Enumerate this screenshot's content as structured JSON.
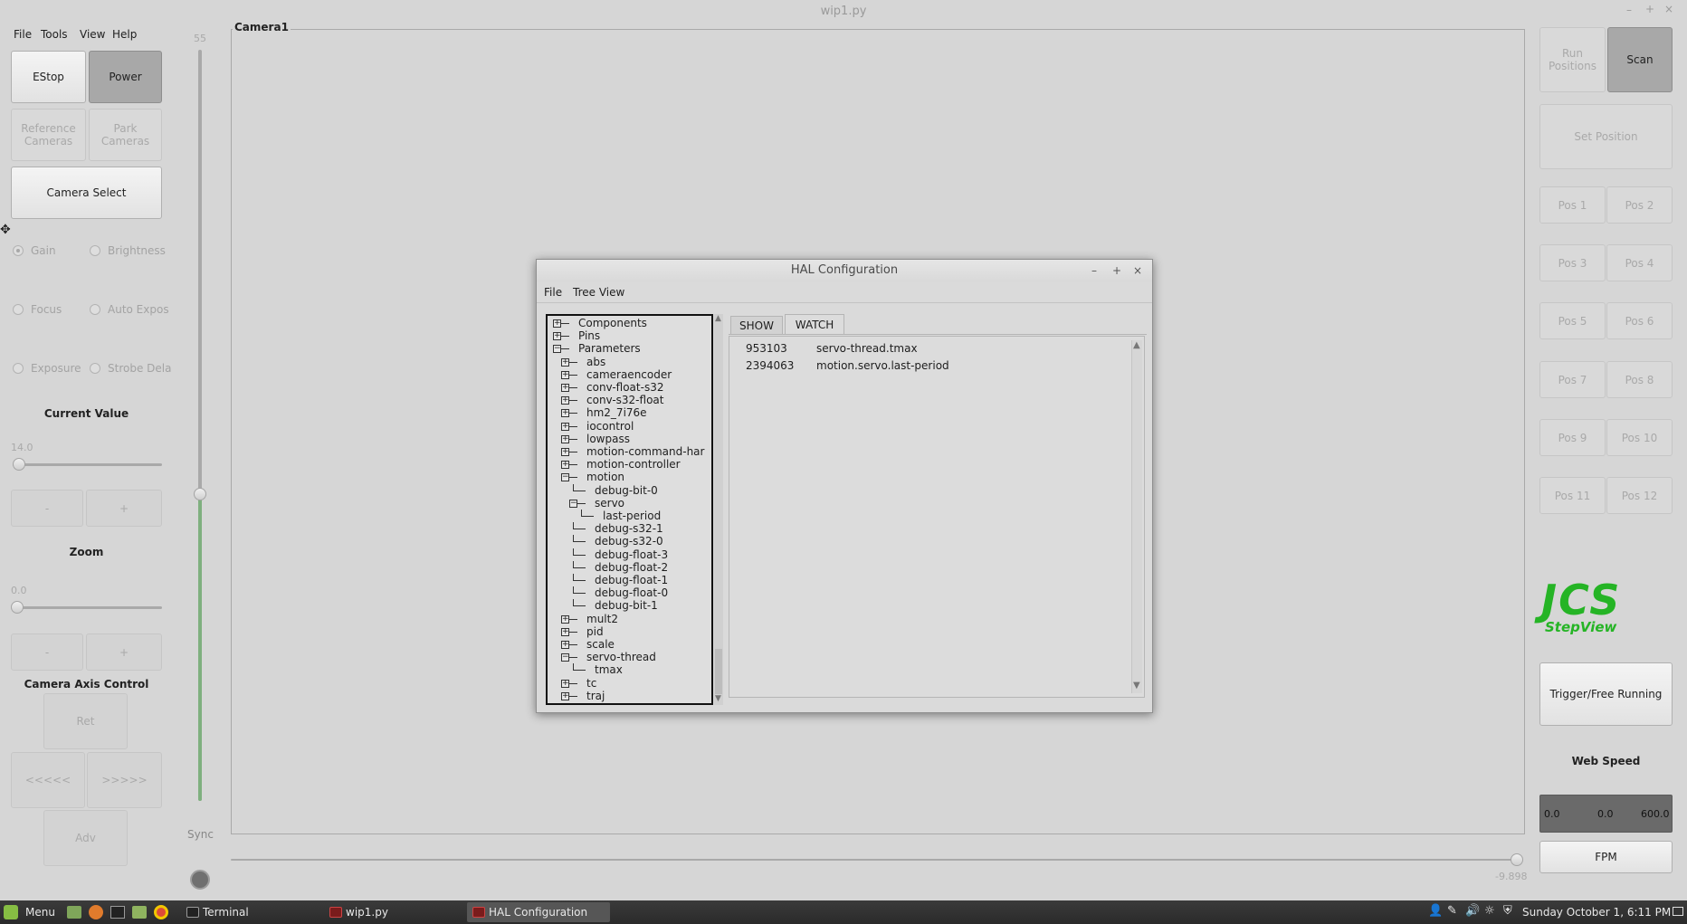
{
  "window": {
    "title": "wip1.py",
    "controls": [
      "–",
      "+",
      "×"
    ]
  },
  "menu": [
    "File",
    "Tools",
    "View",
    "Help"
  ],
  "left": {
    "estop": "EStop",
    "power": "Power",
    "reference_cameras": "Reference Cameras",
    "park_cameras": "Park Cameras",
    "camera_select": "Camera Select",
    "radios": {
      "gain": "Gain",
      "brightness": "Brightness",
      "focus": "Focus",
      "auto_expos": "Auto Expos",
      "exposure": "Exposure",
      "strobe": "Strobe Dela"
    },
    "current_value_label": "Current Value",
    "current_value": "14.0",
    "minus": "-",
    "plus": "+",
    "zoom_label": "Zoom",
    "zoom_value": "0.0",
    "camera_axis_label": "Camera Axis Control",
    "ret": "Ret",
    "back": "<<<<<",
    "forward": ">>>>>",
    "adv": "Adv",
    "vslider_value": "55",
    "vslider_fill": 0.42,
    "sync_label": "Sync"
  },
  "camera": {
    "title": "Camera1",
    "slider_value": "-9.898"
  },
  "right": {
    "run_positions": "Run Positions",
    "scan": "Scan",
    "set_position": "Set Position",
    "positions": [
      "Pos 1",
      "Pos 2",
      "Pos 3",
      "Pos 4",
      "Pos 5",
      "Pos 6",
      "Pos 7",
      "Pos 8",
      "Pos 9",
      "Pos 10",
      "Pos 11",
      "Pos 12"
    ],
    "logo_main": "JCS",
    "logo_sub": "StepView",
    "trigger": "Trigger/Free Running",
    "web_speed_label": "Web Speed",
    "speed_min": "0.0",
    "speed_value": "0.0",
    "speed_max": "600.0",
    "fpm": "FPM"
  },
  "hal": {
    "title": "HAL Configuration",
    "controls": [
      "–",
      "+",
      "×"
    ],
    "menu": [
      "File",
      "Tree View"
    ],
    "tree": [
      {
        "label": "Components",
        "level": 0,
        "sign": "+"
      },
      {
        "label": "Pins",
        "level": 0,
        "sign": "+"
      },
      {
        "label": "Parameters",
        "level": 0,
        "sign": "-"
      },
      {
        "label": "abs",
        "level": 1,
        "sign": "+"
      },
      {
        "label": "cameraencoder",
        "level": 1,
        "sign": "+"
      },
      {
        "label": "conv-float-s32",
        "level": 1,
        "sign": "+"
      },
      {
        "label": "conv-s32-float",
        "level": 1,
        "sign": "+"
      },
      {
        "label": "hm2_7i76e",
        "level": 1,
        "sign": "+"
      },
      {
        "label": "iocontrol",
        "level": 1,
        "sign": "+"
      },
      {
        "label": "lowpass",
        "level": 1,
        "sign": "+"
      },
      {
        "label": "motion-command-har",
        "level": 1,
        "sign": "+"
      },
      {
        "label": "motion-controller",
        "level": 1,
        "sign": "+"
      },
      {
        "label": "motion",
        "level": 1,
        "sign": "-"
      },
      {
        "label": "debug-bit-0",
        "level": 2,
        "sign": ""
      },
      {
        "label": "servo",
        "level": 2,
        "sign": "-"
      },
      {
        "label": "last-period",
        "level": 3,
        "sign": ""
      },
      {
        "label": "debug-s32-1",
        "level": 2,
        "sign": ""
      },
      {
        "label": "debug-s32-0",
        "level": 2,
        "sign": ""
      },
      {
        "label": "debug-float-3",
        "level": 2,
        "sign": ""
      },
      {
        "label": "debug-float-2",
        "level": 2,
        "sign": ""
      },
      {
        "label": "debug-float-1",
        "level": 2,
        "sign": ""
      },
      {
        "label": "debug-float-0",
        "level": 2,
        "sign": ""
      },
      {
        "label": "debug-bit-1",
        "level": 2,
        "sign": ""
      },
      {
        "label": "mult2",
        "level": 1,
        "sign": "+"
      },
      {
        "label": "pid",
        "level": 1,
        "sign": "+"
      },
      {
        "label": "scale",
        "level": 1,
        "sign": "+"
      },
      {
        "label": "servo-thread",
        "level": 1,
        "sign": "-"
      },
      {
        "label": "tmax",
        "level": 2,
        "sign": ""
      },
      {
        "label": "tc",
        "level": 1,
        "sign": "+"
      },
      {
        "label": "traj",
        "level": 1,
        "sign": "+"
      }
    ],
    "tabs": [
      "SHOW",
      "WATCH"
    ],
    "watch": [
      {
        "value": "953103",
        "name": "servo-thread.tmax"
      },
      {
        "value": "2394063",
        "name": "motion.servo.last-period"
      }
    ]
  },
  "taskbar": {
    "menu": "Menu",
    "windows": [
      "Terminal",
      "wip1.py",
      "HAL Configuration"
    ],
    "clock": "Sunday October 1, 6:11 PM"
  }
}
